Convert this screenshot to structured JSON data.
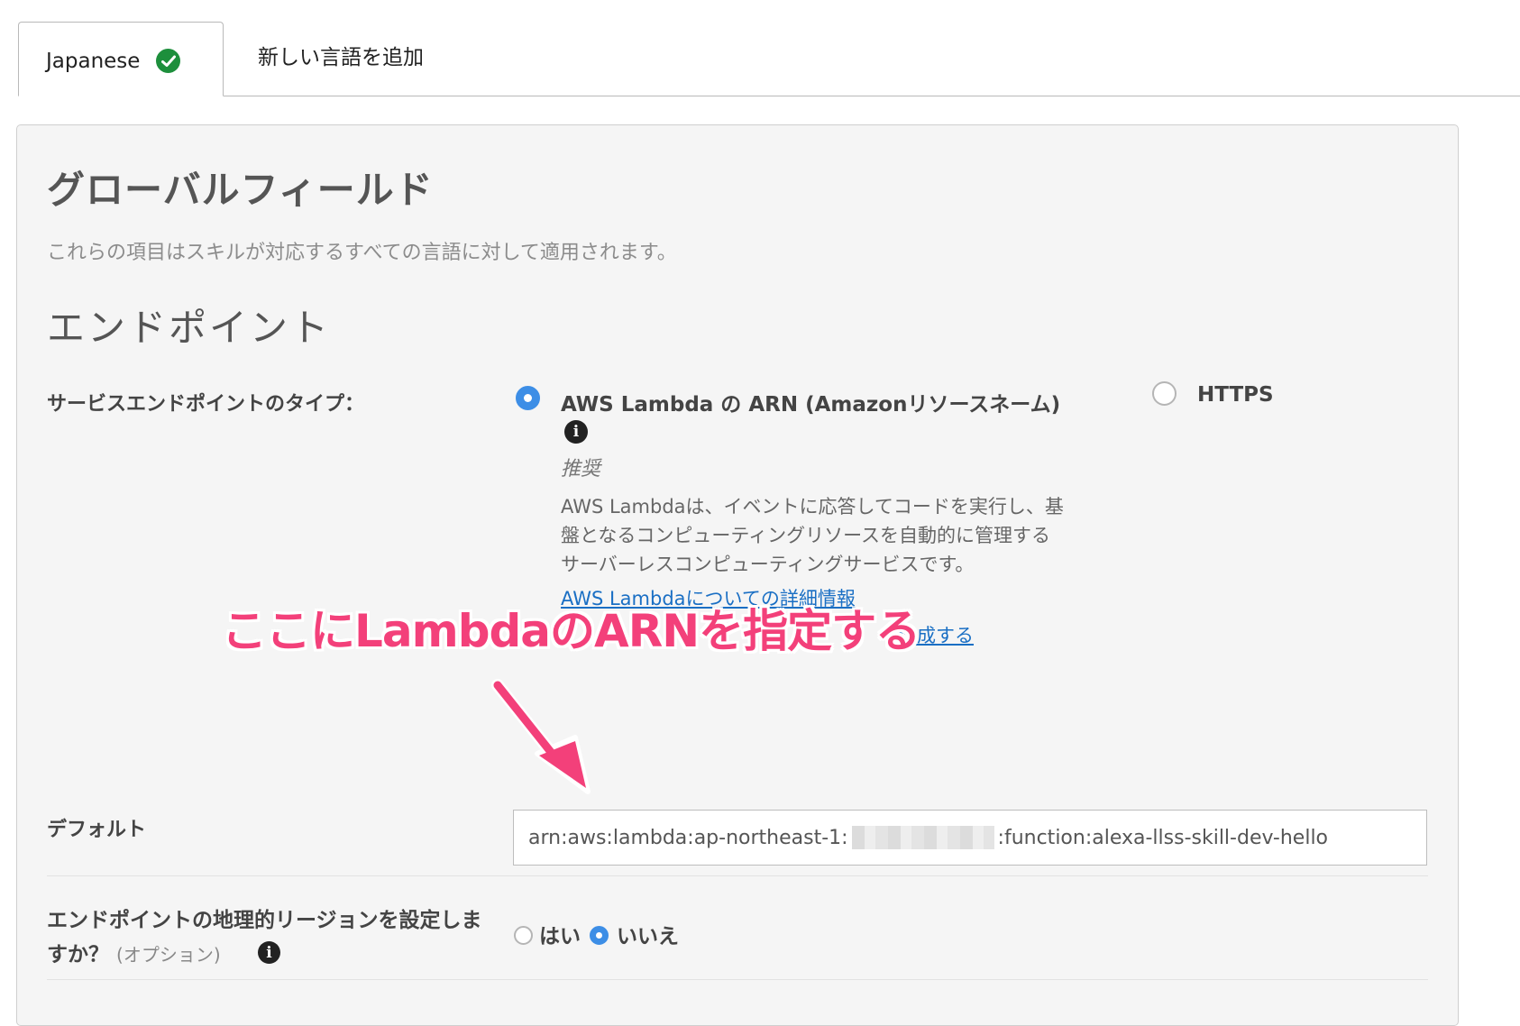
{
  "tabs": {
    "active": "Japanese",
    "add": "新しい言語を追加"
  },
  "global_fields": {
    "title": "グローバルフィールド",
    "description": "これらの項目はスキルが対応するすべての言語に対して適用されます。"
  },
  "endpoint": {
    "title": "エンドポイント",
    "service_type_label": "サービスエンドポイントのタイプ：",
    "lambda_option": "AWS Lambda の ARN (Amazonリソースネーム)",
    "lambda_selected": true,
    "recommended": "推奨",
    "lambda_description_lines": [
      "AWS Lambdaは、イベントに応答してコードを実行し、基",
      "盤となるコンピューティングリソースを自動的に管理する",
      "サーバーレスコンピューティングサービスです。"
    ],
    "link_more_info": "AWS Lambdaについての詳細情報",
    "link_create": "作成する",
    "https_option": "HTTPS",
    "default_label": "デフォルト",
    "arn_prefix": "arn:aws:lambda:ap-northeast-1:",
    "arn_suffix": ":function:alexa-llss-skill-dev-hello",
    "region_question": "エンドポイントの地理的リージョンを設定しますか？",
    "region_optional": "(オプション)",
    "yes": "はい",
    "no": "いいえ",
    "region_selected": "いいえ"
  },
  "annotation": {
    "text": "ここにLambdaのARNを指定する",
    "color": "#f3407a"
  },
  "colors": {
    "accent_blue": "#3d8ee6",
    "success_green": "#1d8f3c",
    "link_blue": "#1a6fc4"
  }
}
